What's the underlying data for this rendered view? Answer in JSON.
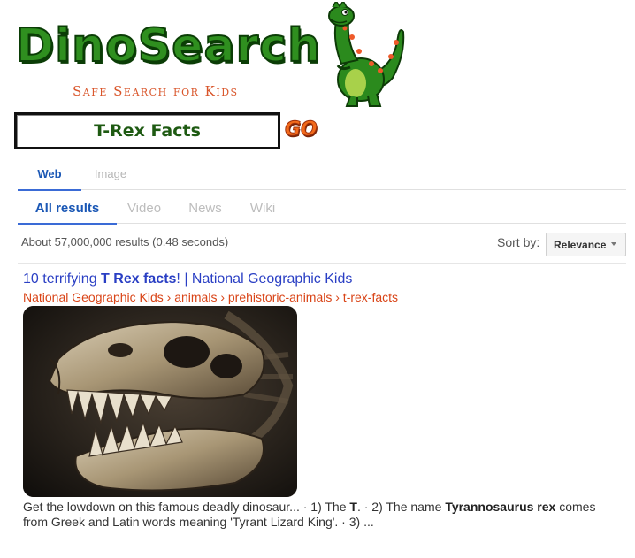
{
  "logo": {
    "title": "DinoSearch",
    "tagline": "Safe Search for Kids"
  },
  "search": {
    "query": "T-Rex Facts",
    "go_label": "GO"
  },
  "top_tabs": [
    {
      "label": "Web",
      "active": true
    },
    {
      "label": "Image",
      "active": false
    }
  ],
  "sub_tabs": [
    {
      "label": "All results",
      "active": true
    },
    {
      "label": "Video",
      "active": false
    },
    {
      "label": "News",
      "active": false
    },
    {
      "label": "Wiki",
      "active": false
    }
  ],
  "results_info": {
    "count_text": "About 57,000,000 results (0.48 seconds)",
    "sort_label": "Sort by:",
    "sort_value": "Relevance"
  },
  "results": [
    {
      "title_prefix": "10 terrifying ",
      "title_bold": "T Rex facts",
      "title_suffix": "! | National Geographic Kids",
      "url": "National Geographic Kids › animals › prehistoric-animals › t-rex-facts",
      "snippet_1": "Get the lowdown on this famous deadly dinosaur... · 1) The ",
      "snippet_b1": "T",
      "snippet_2": ". · 2) The name ",
      "snippet_b2": "Tyrannosaurus rex",
      "snippet_3": " comes from Greek and Latin words meaning 'Tyrant Lizard King'. · 3) ..."
    }
  ],
  "colors": {
    "logo_green": "#2f8f1f",
    "tagline_orange": "#d9552a",
    "link_blue": "#2a3fc4",
    "url_red": "#d94417"
  }
}
